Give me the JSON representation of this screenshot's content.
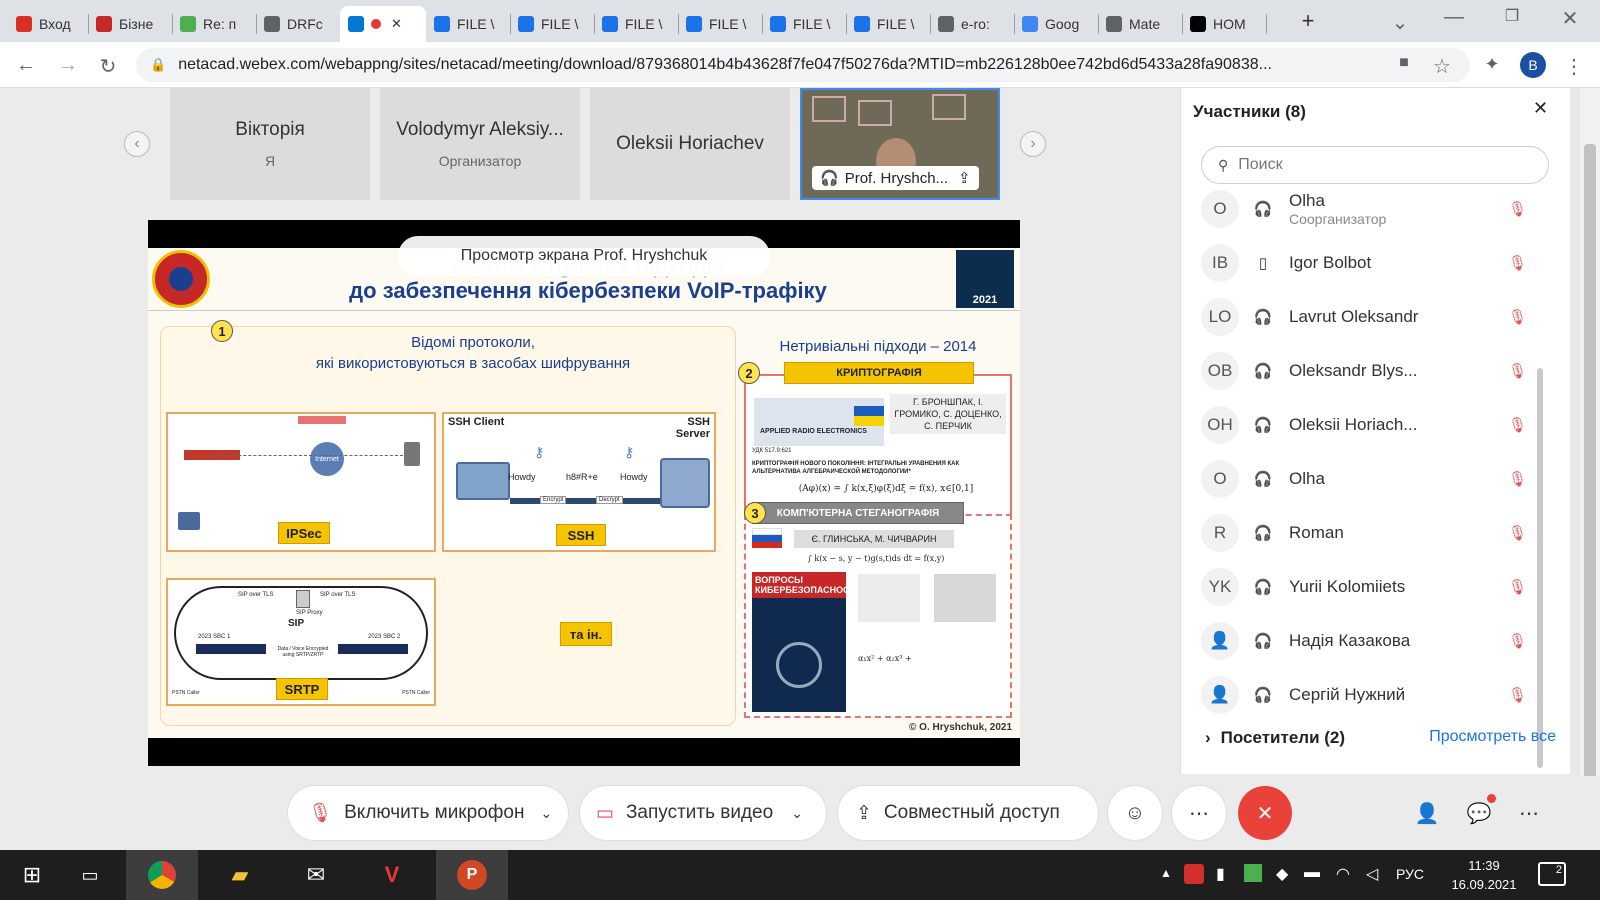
{
  "browser": {
    "tabs": [
      {
        "label": "Вход",
        "icon": "gmail-icon",
        "color": "#d93025"
      },
      {
        "label": "Бізне",
        "icon": "red-square-icon",
        "color": "#c62828"
      },
      {
        "label": "Re: п",
        "icon": "mail-icon",
        "color": "#4caf50"
      },
      {
        "label": "DRFc",
        "icon": "globe-icon",
        "color": "#5f6368"
      },
      {
        "label": "",
        "icon": "webex-icon",
        "color": "#0078d4"
      },
      {
        "label": "FILE \\",
        "icon": "file-icon",
        "color": "#1a73e8"
      },
      {
        "label": "FILE \\",
        "icon": "file-icon",
        "color": "#1a73e8"
      },
      {
        "label": "FILE \\",
        "icon": "file-icon",
        "color": "#1a73e8"
      },
      {
        "label": "FILE \\",
        "icon": "file-icon",
        "color": "#1a73e8"
      },
      {
        "label": "FILE \\",
        "icon": "file-icon",
        "color": "#1a73e8"
      },
      {
        "label": "FILE \\",
        "icon": "file-icon",
        "color": "#1a73e8"
      },
      {
        "label": "e-ro:",
        "icon": "globe-icon",
        "color": "#5f6368"
      },
      {
        "label": "Goog",
        "icon": "google-translate-icon",
        "color": "#4285f4"
      },
      {
        "label": "Mate",
        "icon": "globe-icon",
        "color": "#5f6368"
      },
      {
        "label": "HOM",
        "icon": "wix-icon",
        "color": "#000000"
      }
    ],
    "new_tab": "+",
    "url": "netacad.webex.com/webappng/sites/netacad/meeting/download/879368014b4b43628f7fe047f50276da?MTID=mb226128b0ee742bd6d5433a28fa90838...",
    "profile_initial": "B"
  },
  "meeting": {
    "tiles": [
      {
        "name": "Вікторія",
        "role": "Я"
      },
      {
        "name": "Volodymyr Aleksiy...",
        "role": "Организатор"
      },
      {
        "name": "Oleksii Horiachev",
        "role": ""
      },
      {
        "name": "Prof. Hryshch...",
        "role": ""
      }
    ],
    "share_banner": "Просмотр экрана Prof. Hryshchuk"
  },
  "slide": {
    "title_faded": "Аналіз існуючих підходів",
    "title": "до забезпечення кібербезпеки VoIP-трафіку",
    "logo_right_year": "2021",
    "section1_num": "1",
    "section1_title_line1": "Відомі протоколи,",
    "section1_title_line2": "які використовуються в засобах шифрування",
    "ipsec": "IPSec",
    "ipsec_center": "Internet",
    "ssh": "SSH",
    "ssh_client": "SSH Client",
    "ssh_server": "SSH Server",
    "ssh_howdy1": "Howdy",
    "ssh_mid": "h8#R+e",
    "ssh_howdy2": "Howdy",
    "ssh_enc": "Encrypt",
    "ssh_dec": "Decrypt",
    "sip": "SIP",
    "srtp": "SRTP",
    "sip_over_tls1": "SIP over TLS",
    "sip_over_tls2": "SIP over TLS",
    "sip_proxy": "SIP Proxy",
    "sbc1": "2023 SBC 1",
    "sbc2": "2023 SBC 2",
    "sip_data": "Data / Voice Encrypted using SRTP/ZRTP",
    "pstn1": "PSTN Caller",
    "pstn2": "PSTN Caller",
    "others": "та ін.",
    "right_header": "Нетривіальні підходи – 2014",
    "section2_num": "2",
    "section2": "КРИПТОГРАФІЯ",
    "are_title": "APPLIED RADIO ELECTRONICS",
    "authors2": "Г. БРОНШПАК, І. ГРОМИКО, С. ДОЦЕНКО, С. ПЕРЧИК",
    "udk": "УДК 517.9:621",
    "paper2": "КРИПТОГРАФІЯ НОВОГО ПОКОЛІННЯ: ІНТЕГРАЛЬНІ УРАВНЕНИЯ КАК АЛЬТЕРНАТИВА АЛГЕБРАИЧЕСКОЙ МЕТОДОЛОГИИ*",
    "formula2": "(Aφ)(x) = ∫ k(x,ξ)φ(ξ)dξ = f(x), x∈[0,1]",
    "section3_num": "3",
    "section3": "КОМП'ЮТЕРНА СТЕГАНОГРАФІЯ",
    "authors3": "Є. ГЛИНСЬКА, М. ЧИЧВАРИН",
    "formula3": "∫ k(x − s, y − t)g(s,t)ds dt = f(x,y)",
    "journal": "ВОПРОСЫ КИБЕРБЕЗОПАСНОСТИ",
    "poly": "α₁x² + α₂x³ +",
    "copyright": "© O. Hryshchuk, 2021"
  },
  "participants": {
    "title": "Участники (8)",
    "search_placeholder": "Поиск",
    "list": [
      {
        "initials": "O",
        "name": "Olha",
        "role": "Соорганизатор",
        "device": "headset"
      },
      {
        "initials": "IB",
        "name": "Igor Bolbot",
        "role": "",
        "device": "phone"
      },
      {
        "initials": "LO",
        "name": "Lavrut Oleksandr",
        "role": "",
        "device": "headset"
      },
      {
        "initials": "OB",
        "name": "Oleksandr Blys...",
        "role": "",
        "device": "headset"
      },
      {
        "initials": "OH",
        "name": "Oleksii Horiach...",
        "role": "",
        "device": "headset"
      },
      {
        "initials": "O",
        "name": "Olha",
        "role": "",
        "device": "headset"
      },
      {
        "initials": "R",
        "name": "Roman",
        "role": "",
        "device": "headset"
      },
      {
        "initials": "YK",
        "name": "Yurii Kolomiiets",
        "role": "",
        "device": "headset"
      },
      {
        "initials": "",
        "name": "Надія Казакова",
        "role": "",
        "device": "headset"
      },
      {
        "initials": "",
        "name": "Сергій Нужний",
        "role": "",
        "device": "headset"
      }
    ],
    "visitors": "Посетители (2)",
    "view_all": "Просмотреть все"
  },
  "controls": {
    "mic": "Включить микрофон",
    "video": "Запустить видео",
    "share": "Совместный доступ"
  },
  "taskbar": {
    "language": "РУС",
    "time": "11:39",
    "date": "16.09.2021",
    "notifications": "2"
  },
  "colors": {
    "accent": "#1a73e8",
    "end_call": "#e8423b",
    "slide_title": "#1a3f8f",
    "mute": "#e05050"
  }
}
